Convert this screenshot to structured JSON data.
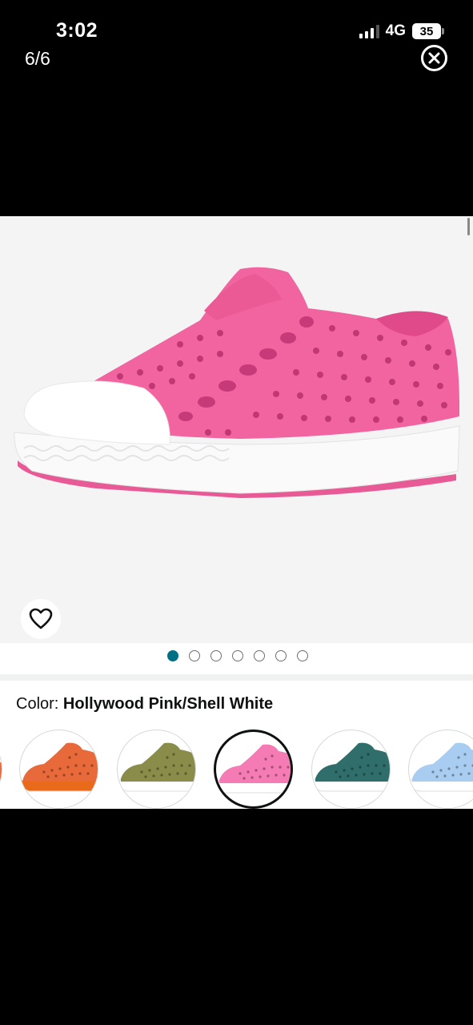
{
  "status_bar": {
    "time": "3:02",
    "network": "4G",
    "battery": "35"
  },
  "viewer": {
    "counter": "6/6"
  },
  "carousel": {
    "dot_count": 7,
    "active_index": 0
  },
  "color_selector": {
    "label": "Color: ",
    "selected_value": "Hollywood Pink/Shell White",
    "swatches": [
      {
        "color": "#e8693a",
        "sole": "#e86a1a"
      },
      {
        "color": "#8a8c4a",
        "sole": "#ffffff"
      },
      {
        "color": "#f47bb3",
        "sole": "#ffffff",
        "selected": true
      },
      {
        "color": "#2f6e6a",
        "sole": "#ffffff"
      },
      {
        "color": "#a9cdf0",
        "sole": "#ffffff"
      }
    ]
  },
  "colors": {
    "accent": "#007185",
    "product": "#f2649f",
    "toe_cap": "#ffffff"
  }
}
